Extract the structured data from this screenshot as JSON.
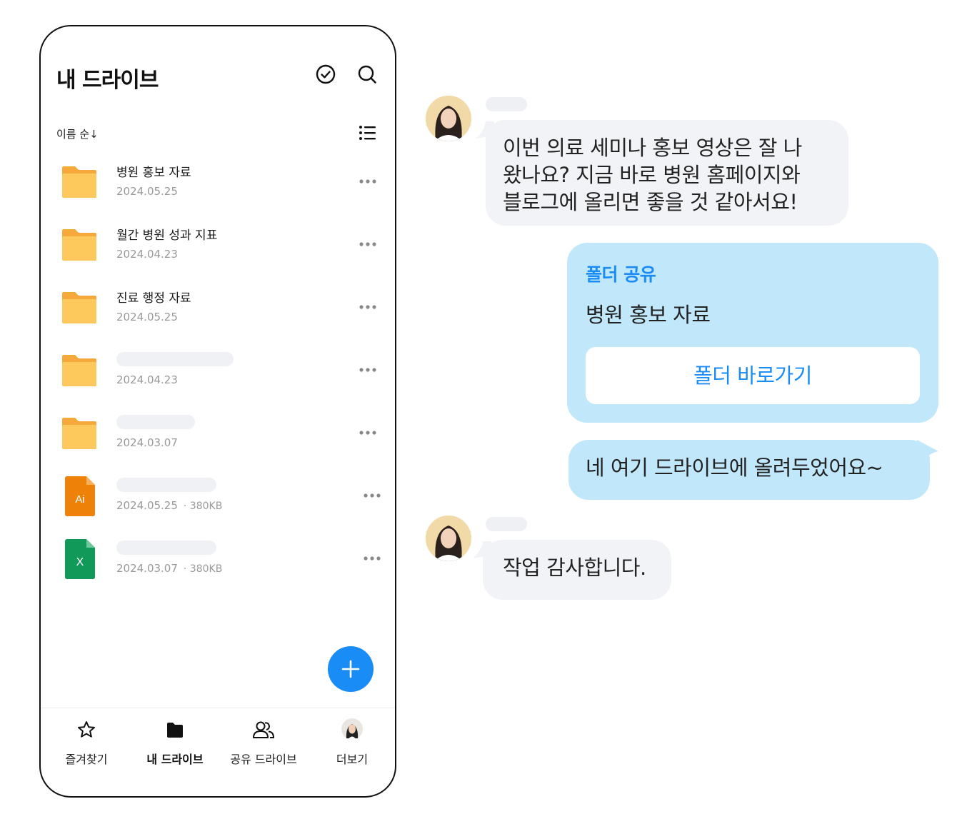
{
  "drive": {
    "title": "내 드라이브",
    "sort_label": "이름 순↓",
    "files": [
      {
        "name": "병원 홍보 자료",
        "date": "2024.05.25",
        "size": "",
        "type": "folder",
        "icon": "folder-icon"
      },
      {
        "name": "월간 병원 성과 지표",
        "date": "2024.04.23",
        "size": "",
        "type": "folder",
        "icon": "folder-icon"
      },
      {
        "name": "진료 행정 자료",
        "date": "2024.05.25",
        "size": "",
        "type": "folder",
        "icon": "folder-icon"
      },
      {
        "name": "",
        "date": "2024.04.23",
        "size": "",
        "type": "folder",
        "icon": "folder-icon"
      },
      {
        "name": "",
        "date": "2024.03.07",
        "size": "",
        "type": "folder",
        "icon": "folder-icon"
      },
      {
        "name": "",
        "date": "2024.05.25",
        "size": "· 380KB",
        "type": "ai",
        "icon": "illustrator-file-icon",
        "badge": "Ai"
      },
      {
        "name": "",
        "date": "2024.03.07",
        "size": "· 380KB",
        "type": "xls",
        "icon": "excel-file-icon",
        "badge": "X"
      }
    ]
  },
  "tabs": [
    {
      "label": "즐겨찾기",
      "icon": "star-icon",
      "active": false
    },
    {
      "label": "내 드라이브",
      "icon": "folder-icon",
      "active": true
    },
    {
      "label": "공유 드라이브",
      "icon": "people-icon",
      "active": false
    },
    {
      "label": "더보기",
      "icon": "avatar",
      "active": false
    }
  ],
  "chat": {
    "msg1_lines": [
      "이번 의료 세미나 홍보 영상은 잘 나",
      "왔나요? 지금 바로 병원 홈페이지와",
      "블로그에 올리면 좋을 것 같아서요!"
    ],
    "share_card": {
      "label": "폴더 공유",
      "folder": "병원 홍보 자료",
      "button": "폴더 바로가기"
    },
    "msg2": "네 여기 드라이브에 올려두었어요~",
    "msg3": "작업 감사합니다."
  },
  "colors": {
    "accent": "#1a8cf5",
    "folder": "#fec95c",
    "outgoing_bubble": "#c1e7fa",
    "incoming_bubble": "#f2f3f6",
    "ai_file": "#ee8208",
    "xls_file": "#109958"
  }
}
